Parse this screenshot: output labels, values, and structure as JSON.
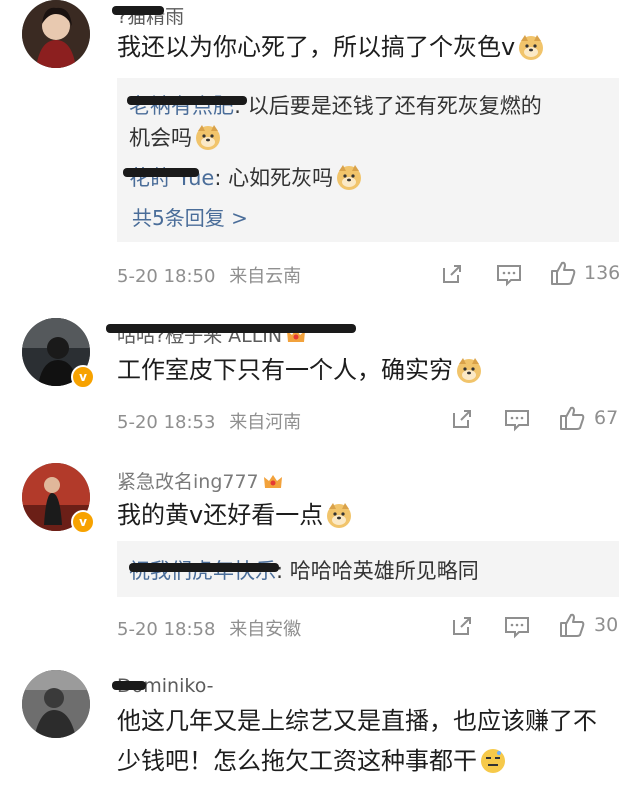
{
  "colors": {
    "link": "#4a6d99",
    "meta": "#8f8f8f",
    "badge": "#f7a200",
    "reply_bg": "#f4f4f4"
  },
  "comments": [
    {
      "username": "?猫精雨",
      "text": "我还以为你心死了，所以搞了个灰色v",
      "replies": [
        {
          "name": "老衲有点肥",
          "text": "以后要是还钱了还有死灰复燃的",
          "text2": "机会吗"
        },
        {
          "name": "花莳 Yue",
          "text": "心如死灰吗"
        }
      ],
      "more_replies": "共5条回复 >",
      "time": "5-20 18:50",
      "location": "来自云南",
      "likes": "136"
    },
    {
      "username": "咕咕?橙子来 ALLIN",
      "text": "工作室皮下只有一个人，确实穷",
      "verified": "v",
      "time": "5-20 18:53",
      "location": "来自河南",
      "likes": "67"
    },
    {
      "username": "紧急改名ing777",
      "text": "我的黄v还好看一点",
      "verified": "v",
      "replies": [
        {
          "name": "祝我们虎年快乐",
          "text": "哈哈哈英雄所见略同"
        }
      ],
      "time": "5-20 18:58",
      "location": "来自安徽",
      "likes": "30"
    },
    {
      "username": "Dominiko-",
      "text": "他这几年又是上综艺又是直播，也应该赚了不",
      "text2": "少钱吧！怎么拖欠工资这种事都干"
    }
  ]
}
